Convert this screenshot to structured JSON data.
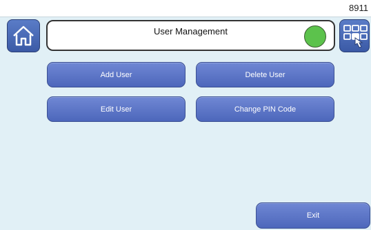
{
  "screen_id": "8911",
  "header": {
    "title": "User Management",
    "status_color": "#5cc24c",
    "home_icon": "home-icon",
    "menu_icon": "grid-hand-icon"
  },
  "actions": {
    "add_user": "Add User",
    "delete_user": "Delete User",
    "edit_user": "Edit User",
    "change_pin": "Change PIN Code",
    "exit": "Exit"
  },
  "colors": {
    "panel_bg": "#e1f0f6",
    "button_blue": "#5a74c8"
  }
}
